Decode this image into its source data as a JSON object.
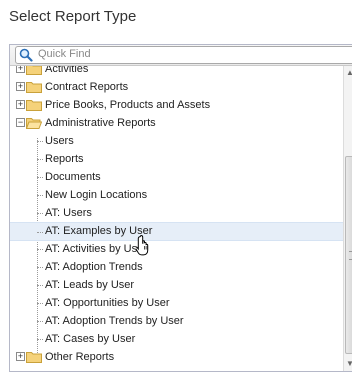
{
  "dialog": {
    "title": "Select Report Type"
  },
  "search": {
    "placeholder": "Quick Find"
  },
  "tree": {
    "folders_top": [
      {
        "label": "Activities",
        "state": "collapsed"
      },
      {
        "label": "Contract Reports",
        "state": "collapsed"
      },
      {
        "label": "Price Books, Products and Assets",
        "state": "collapsed"
      },
      {
        "label": "Administrative Reports",
        "state": "expanded"
      }
    ],
    "children": [
      {
        "label": "Users"
      },
      {
        "label": "Reports"
      },
      {
        "label": "Documents"
      },
      {
        "label": "New Login Locations"
      },
      {
        "label": "AT: Users"
      },
      {
        "label": "AT: Examples by User",
        "selected": true
      },
      {
        "label": "AT: Activities by User"
      },
      {
        "label": "AT: Adoption Trends"
      },
      {
        "label": "AT: Leads by User"
      },
      {
        "label": "AT: Opportunities by User"
      },
      {
        "label": "AT: Adoption Trends by User"
      },
      {
        "label": "AT: Cases by User"
      }
    ],
    "folders_bottom": [
      {
        "label": "Other Reports",
        "state": "collapsed"
      }
    ]
  },
  "icons": {
    "search": "search-icon",
    "folder": "folder-icon",
    "expand": "plus-toggle-icon",
    "collapse": "minus-toggle-icon",
    "cursor": "hand-cursor-icon"
  },
  "colors": {
    "selection": "#e6eef8",
    "folder": "#f2c94c"
  }
}
